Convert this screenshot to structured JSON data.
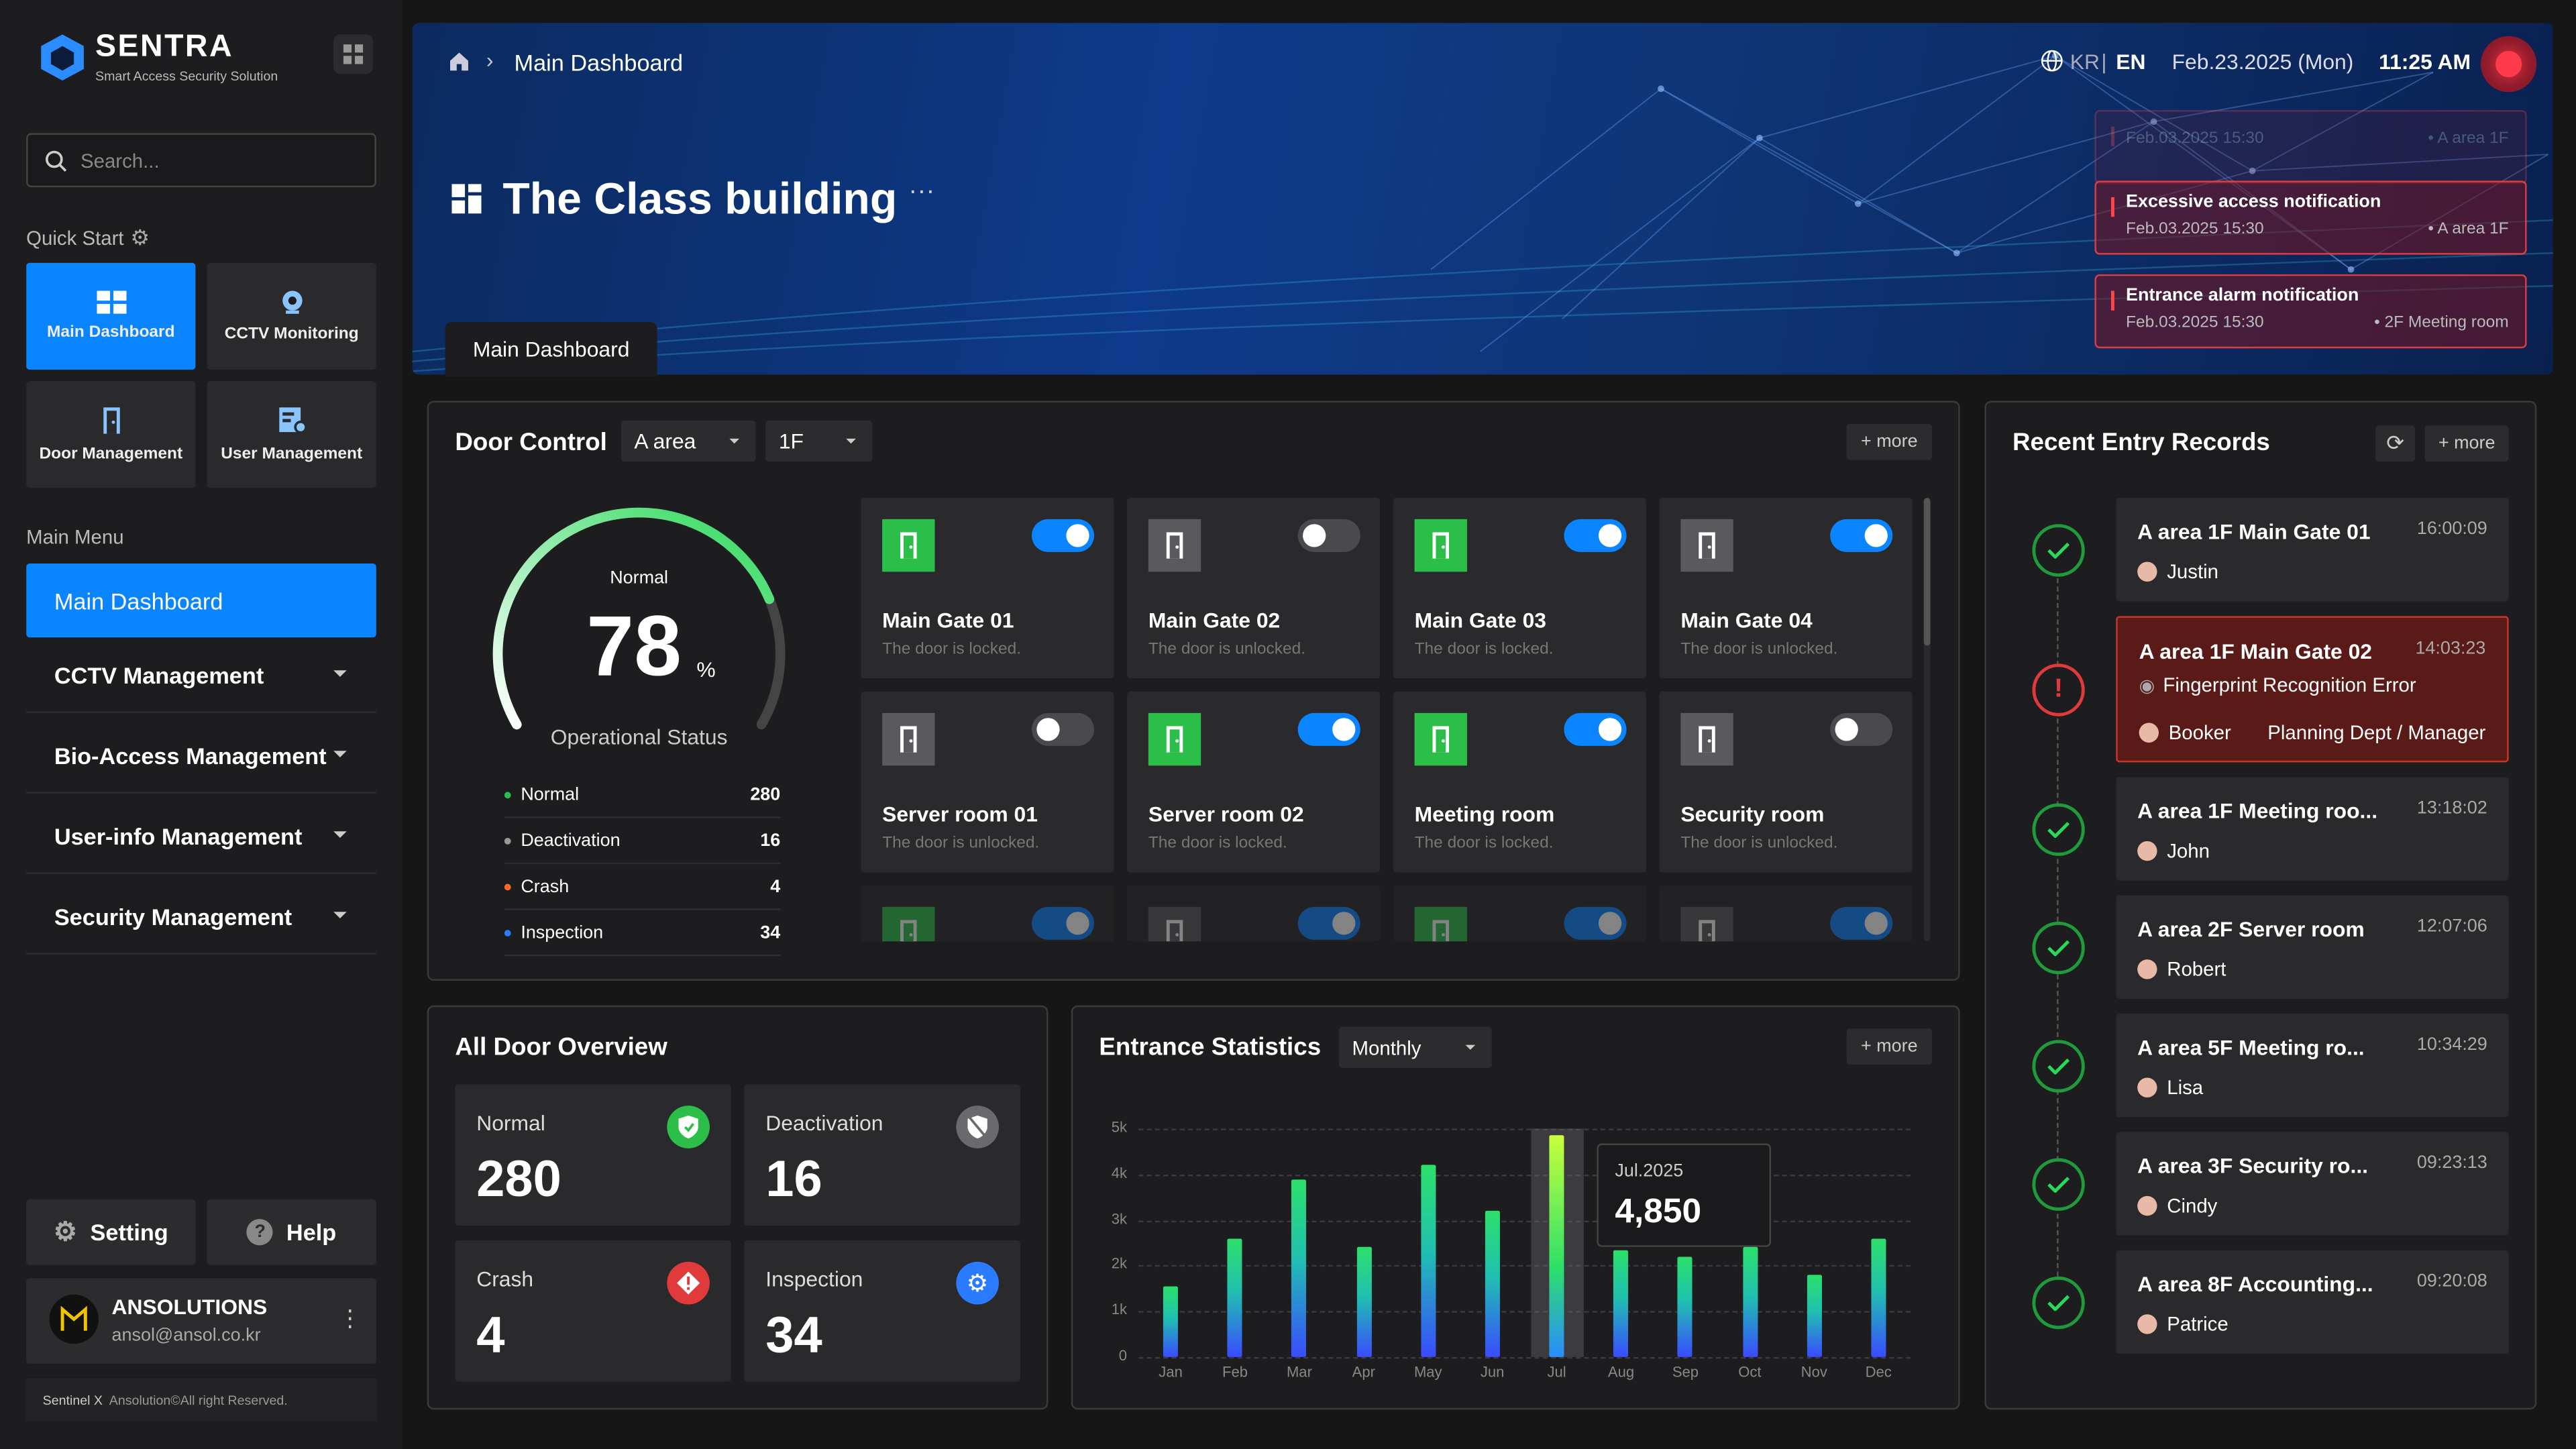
{
  "app": {
    "name": "SENTRA",
    "tagline": "Smart Access Security Solution"
  },
  "search": {
    "placeholder": "Search..."
  },
  "quick_start": {
    "title": "Quick Start",
    "tiles": [
      {
        "label": "Main Dashboard"
      },
      {
        "label": "CCTV Monitoring"
      },
      {
        "label": "Door Management"
      },
      {
        "label": "User Management"
      }
    ]
  },
  "main_menu": {
    "title": "Main Menu",
    "items": [
      {
        "label": "Main Dashboard"
      },
      {
        "label": "CCTV Management"
      },
      {
        "label": "Bio-Access Management"
      },
      {
        "label": "User-info Management"
      },
      {
        "label": "Security Management"
      }
    ]
  },
  "footer_buttons": {
    "setting": "Setting",
    "help": "Help"
  },
  "user": {
    "name": "ANSOLUTIONS",
    "email": "ansol@ansol.co.kr"
  },
  "copyright": {
    "brand": "Sentinel X",
    "text": "Ansolution©All right Reserved."
  },
  "header": {
    "breadcrumb": "Main Dashboard",
    "lang_kr": "KR",
    "lang_sep": "|",
    "lang_en": "EN",
    "date": "Feb.23.2025 (Mon)",
    "time": "11:25 AM",
    "building": "The Class building",
    "tab": "Main Dashboard"
  },
  "notifications": [
    {
      "title": "",
      "date": "Feb.03.2025 15:30",
      "loc": "• A area 1F"
    },
    {
      "title": "Excessive access notification",
      "date": "Feb.03.2025 15:30",
      "loc": "• A area 1F"
    },
    {
      "title": "Entrance alarm notification",
      "date": "Feb.03.2025 15:30",
      "loc": "• 2F Meeting room"
    }
  ],
  "door_control": {
    "title": "Door Control",
    "area": "A area",
    "floor": "1F",
    "more": "+ more",
    "gauge": {
      "label": "Normal",
      "value": "78",
      "unit": "%",
      "caption": "Operational Status",
      "fraction": 0.78
    },
    "stats": [
      {
        "label": "Normal",
        "value": "280",
        "color": "#2bbf4a"
      },
      {
        "label": "Deactivation",
        "value": "16",
        "color": "#9a9a9a"
      },
      {
        "label": "Crash",
        "value": "4",
        "color": "#ff6a2a"
      },
      {
        "label": "Inspection",
        "value": "34",
        "color": "#2a7bff"
      }
    ],
    "doors": [
      {
        "name": "Main Gate 01",
        "status": "The door is locked.",
        "on": true
      },
      {
        "name": "Main Gate 02",
        "status": "The door is unlocked.",
        "on": false
      },
      {
        "name": "Main Gate 03",
        "status": "The door is locked.",
        "on": true
      },
      {
        "name": "Main Gate 04",
        "status": "The door is unlocked.",
        "on": true
      },
      {
        "name": "Server room 01",
        "status": "The door is unlocked.",
        "on": false
      },
      {
        "name": "Server room 02",
        "status": "The door is locked.",
        "on": true
      },
      {
        "name": "Meeting room",
        "status": "The door is locked.",
        "on": true
      },
      {
        "name": "Security room",
        "status": "The door is unlocked.",
        "on": false
      }
    ]
  },
  "overview": {
    "title": "All Door Overview",
    "items": [
      {
        "label": "Normal",
        "value": "280"
      },
      {
        "label": "Deactivation",
        "value": "16"
      },
      {
        "label": "Crash",
        "value": "4"
      },
      {
        "label": "Inspection",
        "value": "34"
      }
    ]
  },
  "entrance": {
    "title": "Entrance Statistics",
    "period": "Monthly",
    "more": "+ more",
    "tooltip": {
      "label": "Jul.2025",
      "value": "4,850"
    }
  },
  "chart_data": {
    "type": "bar",
    "categories": [
      "Jan",
      "Feb",
      "Mar",
      "Apr",
      "May",
      "Jun",
      "Jul",
      "Aug",
      "Sep",
      "Oct",
      "Nov",
      "Dec"
    ],
    "values": [
      1550,
      2600,
      3900,
      2400,
      4200,
      3200,
      4850,
      2350,
      2200,
      2400,
      1800,
      2600
    ],
    "ylim": [
      0,
      5000
    ],
    "yticks": [
      "0",
      "1k",
      "2k",
      "3k",
      "4k",
      "5k"
    ],
    "highlight": "Jul",
    "grid": true
  },
  "records": {
    "title": "Recent Entry Records",
    "more": "+ more",
    "items": [
      {
        "loc": "A area 1F Main Gate 01",
        "time": "16:00:09",
        "who": "Justin",
        "error": false
      },
      {
        "loc": "A area 1F Main Gate 02",
        "time": "14:03:23",
        "who": "Booker",
        "dept": "Planning Dept / Manager",
        "err": "Fingerprint Recognition Error",
        "error": true
      },
      {
        "loc": "A area 1F Meeting roo...",
        "time": "13:18:02",
        "who": "John",
        "error": false
      },
      {
        "loc": "A area 2F Server room",
        "time": "12:07:06",
        "who": "Robert",
        "error": false
      },
      {
        "loc": "A area 5F Meeting ro...",
        "time": "10:34:29",
        "who": "Lisa",
        "error": false
      },
      {
        "loc": "A area 3F Security ro...",
        "time": "09:23:13",
        "who": "Cindy",
        "error": false
      },
      {
        "loc": "A area 8F Accounting...",
        "time": "09:20:08",
        "who": "Patrice",
        "error": false
      }
    ]
  }
}
